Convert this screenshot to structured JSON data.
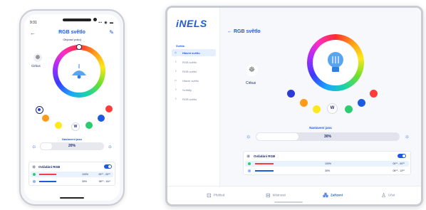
{
  "phone": {
    "status_time": "9:31",
    "status_icons": "▪▪ ◉ ▬",
    "title": "RGB světlo",
    "room": "Obývací pokoj",
    "room_tile_label": "Cirkus",
    "white_label": "W",
    "set_label": "Nastavení jasu",
    "brightness": "20%",
    "brightness_value": 0.2,
    "rgb_label": "Ovládání RGB",
    "rows": [
      {
        "color": "#ff3b3b",
        "pct": "100%",
        "time": "00⁰⁰ - 00⁰⁰",
        "dot": "#2ecc71"
      },
      {
        "color": "#1e5ae0",
        "pct": "30%",
        "time": "06⁰⁰ - 16³⁰",
        "dot": "#8ab4ff"
      }
    ]
  },
  "tablet": {
    "brand": "iNELS",
    "sidebar_head": "Světla",
    "sidebar_items": [
      "Hlavní světlo",
      "RGB světlo",
      "RGB světlo",
      "Hlavní světlo",
      "Svítidly",
      "RGB světlo"
    ],
    "back_title": "RGB světlo",
    "room_tile_label": "Cirkus",
    "white_label": "W",
    "set_label": "Nastavení jasu",
    "brightness": "30%",
    "brightness_value": 0.3,
    "rgb_label": "Ovládání RGB",
    "rows": [
      {
        "color": "#ff3b3b",
        "pct": "100%",
        "time": "00⁰⁰ - 00⁰⁰",
        "dot": "#2ecc71"
      },
      {
        "color": "#1e5ae0",
        "pct": "30%",
        "time": "06⁰⁰ - 13⁰⁰",
        "dot": "#8ab4ff"
      }
    ],
    "nav": [
      "Přehled",
      "Místnosti",
      "Zařízení",
      "Účet"
    ]
  },
  "colors": {
    "accent": "#1e5ae0",
    "presets": [
      "#2a3bd6",
      "#ff3b3b",
      "#ff9a1a",
      "#ffe81a",
      "#2ecc71",
      "#1aa7ff"
    ]
  }
}
